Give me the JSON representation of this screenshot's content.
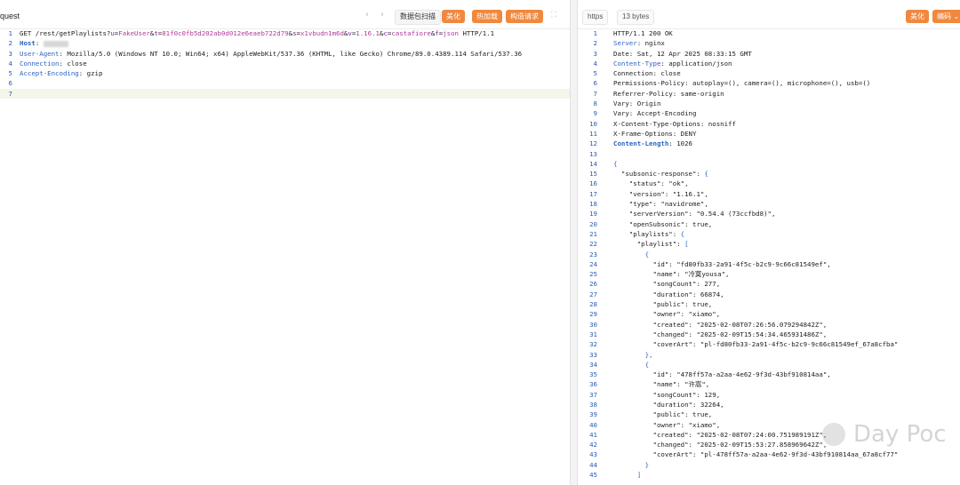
{
  "left": {
    "title": "quest",
    "buttons": {
      "capture": "数据包扫描",
      "beautify": "美化",
      "hot_load": "热加载",
      "build_request": "构造请求"
    },
    "lines": [
      {
        "n": "1",
        "segs": [
          [
            "t",
            "GET /rest/getPlaylists?"
          ],
          [
            "p",
            "u"
          ],
          [
            "t",
            "="
          ],
          [
            "v",
            "FakeUser"
          ],
          [
            "t",
            "&"
          ],
          [
            "p",
            "t"
          ],
          [
            "t",
            "="
          ],
          [
            "v",
            "81f0c0fb5d202ab0d012e6eaeb722d79"
          ],
          [
            "t",
            "&"
          ],
          [
            "p",
            "s"
          ],
          [
            "t",
            "="
          ],
          [
            "v",
            "x1vbudn1m6d"
          ],
          [
            "t",
            "&"
          ],
          [
            "p",
            "v"
          ],
          [
            "t",
            "="
          ],
          [
            "v",
            "1.16.1"
          ],
          [
            "t",
            "&"
          ],
          [
            "p",
            "c"
          ],
          [
            "t",
            "="
          ],
          [
            "v",
            "castafiore"
          ],
          [
            "t",
            "&"
          ],
          [
            "p",
            "f"
          ],
          [
            "t",
            "="
          ],
          [
            "v",
            "json"
          ],
          [
            "t",
            " HTTP/1.1"
          ]
        ]
      },
      {
        "n": "2",
        "segs": [
          [
            "b",
            "Host"
          ],
          [
            "t",
            ": "
          ],
          [
            "blur",
            ""
          ]
        ]
      },
      {
        "n": "3",
        "segs": [
          [
            "k",
            "User-Agent"
          ],
          [
            "t",
            ": Mozilla/5.0 (Windows NT 10.0; Win64; x64) AppleWebKit/537.36 (KHTML, like Gecko) Chrome/89.0.4389.114 Safari/537.36"
          ]
        ]
      },
      {
        "n": "4",
        "segs": [
          [
            "k",
            "Connection"
          ],
          [
            "t",
            ": close"
          ]
        ]
      },
      {
        "n": "5",
        "segs": [
          [
            "k",
            "Accept-Encoding"
          ],
          [
            "t",
            ": gzip"
          ]
        ]
      },
      {
        "n": "6",
        "segs": [
          [
            "t",
            ""
          ]
        ]
      },
      {
        "n": "7",
        "segs": [
          [
            "t",
            ""
          ]
        ],
        "hl": true
      }
    ]
  },
  "right": {
    "protocol_tag": "https",
    "size_tag": "13 bytes",
    "buttons": {
      "beautify": "美化",
      "encode": "编码"
    },
    "lines": [
      {
        "n": "1",
        "segs": [
          [
            "t",
            "HTTP/1.1 200 OK"
          ]
        ]
      },
      {
        "n": "2",
        "segs": [
          [
            "k",
            "Server"
          ],
          [
            "t",
            ": nginx"
          ]
        ]
      },
      {
        "n": "3",
        "segs": [
          [
            "t",
            "Date: Sat, 12 Apr 2025 08:33:15 GMT"
          ]
        ]
      },
      {
        "n": "4",
        "segs": [
          [
            "k",
            "Content-Type"
          ],
          [
            "t",
            ": application/json"
          ]
        ]
      },
      {
        "n": "5",
        "segs": [
          [
            "t",
            "Connection: close"
          ]
        ]
      },
      {
        "n": "6",
        "segs": [
          [
            "t",
            "Permissions-Policy: autoplay=(), camera=(), microphone=(), usb=()"
          ]
        ]
      },
      {
        "n": "7",
        "segs": [
          [
            "t",
            "Referrer-Policy: same-origin"
          ]
        ]
      },
      {
        "n": "8",
        "segs": [
          [
            "t",
            "Vary: Origin"
          ]
        ]
      },
      {
        "n": "9",
        "segs": [
          [
            "t",
            "Vary: Accept-Encoding"
          ]
        ]
      },
      {
        "n": "10",
        "segs": [
          [
            "t",
            "X-Content-Type-Options: nosniff"
          ]
        ]
      },
      {
        "n": "11",
        "segs": [
          [
            "t",
            "X-Frame-Options: DENY"
          ]
        ]
      },
      {
        "n": "12",
        "segs": [
          [
            "b",
            "Content-Length"
          ],
          [
            "t",
            ": 1026"
          ]
        ]
      },
      {
        "n": "13",
        "segs": [
          [
            "t",
            ""
          ]
        ]
      },
      {
        "n": "14",
        "segs": [
          [
            "k",
            "{"
          ]
        ]
      },
      {
        "n": "15",
        "segs": [
          [
            "t",
            "  \"subsonic-response\": "
          ],
          [
            "k",
            "{"
          ]
        ]
      },
      {
        "n": "16",
        "segs": [
          [
            "t",
            "    \"status\": \"ok\","
          ]
        ]
      },
      {
        "n": "17",
        "segs": [
          [
            "t",
            "    \"version\": \"1.16.1\","
          ]
        ]
      },
      {
        "n": "18",
        "segs": [
          [
            "t",
            "    \"type\": \"navidrome\","
          ]
        ]
      },
      {
        "n": "19",
        "segs": [
          [
            "t",
            "    \"serverVersion\": \"0.54.4 (73ccfbd8)\","
          ]
        ]
      },
      {
        "n": "20",
        "segs": [
          [
            "t",
            "    \"openSubsonic\": true,"
          ]
        ]
      },
      {
        "n": "21",
        "segs": [
          [
            "t",
            "    \"playlists\": "
          ],
          [
            "k",
            "{"
          ]
        ]
      },
      {
        "n": "22",
        "segs": [
          [
            "t",
            "      \"playlist\": "
          ],
          [
            "k",
            "["
          ]
        ]
      },
      {
        "n": "23",
        "segs": [
          [
            "t",
            "        "
          ],
          [
            "k",
            "{"
          ]
        ]
      },
      {
        "n": "24",
        "segs": [
          [
            "t",
            "          \"id\": \"fd80fb33-2a91-4f5c-b2c9-9c66c81549ef\","
          ]
        ]
      },
      {
        "n": "25",
        "segs": [
          [
            "t",
            "          \"name\": \"冷寞yousa\","
          ]
        ]
      },
      {
        "n": "26",
        "segs": [
          [
            "t",
            "          \"songCount\": 277,"
          ]
        ]
      },
      {
        "n": "27",
        "segs": [
          [
            "t",
            "          \"duration\": 66874,"
          ]
        ]
      },
      {
        "n": "28",
        "segs": [
          [
            "t",
            "          \"public\": true,"
          ]
        ]
      },
      {
        "n": "29",
        "segs": [
          [
            "t",
            "          \"owner\": \"xiamo\","
          ]
        ]
      },
      {
        "n": "30",
        "segs": [
          [
            "t",
            "          \"created\": \"2025-02-08T07:26:56.079294842Z\","
          ]
        ]
      },
      {
        "n": "31",
        "segs": [
          [
            "t",
            "          \"changed\": \"2025-02-09T15:54:34.465931486Z\","
          ]
        ]
      },
      {
        "n": "32",
        "segs": [
          [
            "t",
            "          \"coverArt\": \"pl-fd80fb33-2a91-4f5c-b2c9-9c66c81549ef_67a8cfba\""
          ]
        ]
      },
      {
        "n": "33",
        "segs": [
          [
            "t",
            "        "
          ],
          [
            "k",
            "},"
          ]
        ]
      },
      {
        "n": "34",
        "segs": [
          [
            "t",
            "        "
          ],
          [
            "k",
            "{"
          ]
        ]
      },
      {
        "n": "35",
        "segs": [
          [
            "t",
            "          \"id\": \"478ff57a-a2aa-4e62-9f3d-43bf910814aa\","
          ]
        ]
      },
      {
        "n": "36",
        "segs": [
          [
            "t",
            "          \"name\": \"许嵩\","
          ]
        ]
      },
      {
        "n": "37",
        "segs": [
          [
            "t",
            "          \"songCount\": 129,"
          ]
        ]
      },
      {
        "n": "38",
        "segs": [
          [
            "t",
            "          \"duration\": 32264,"
          ]
        ]
      },
      {
        "n": "39",
        "segs": [
          [
            "t",
            "          \"public\": true,"
          ]
        ]
      },
      {
        "n": "40",
        "segs": [
          [
            "t",
            "          \"owner\": \"xiamo\","
          ]
        ]
      },
      {
        "n": "41",
        "segs": [
          [
            "t",
            "          \"created\": \"2025-02-08T07:24:00.751989191Z\","
          ]
        ]
      },
      {
        "n": "42",
        "segs": [
          [
            "t",
            "          \"changed\": \"2025-02-09T15:53:27.858969642Z\","
          ]
        ]
      },
      {
        "n": "43",
        "segs": [
          [
            "t",
            "          \"coverArt\": \"pl-478ff57a-a2aa-4e62-9f3d-43bf910814aa_67a8cf77\""
          ]
        ]
      },
      {
        "n": "44",
        "segs": [
          [
            "t",
            "        "
          ],
          [
            "k",
            "}"
          ]
        ]
      },
      {
        "n": "45",
        "segs": [
          [
            "t",
            "      "
          ],
          [
            "k",
            "]"
          ]
        ]
      }
    ]
  },
  "watermark": "Day Poc"
}
